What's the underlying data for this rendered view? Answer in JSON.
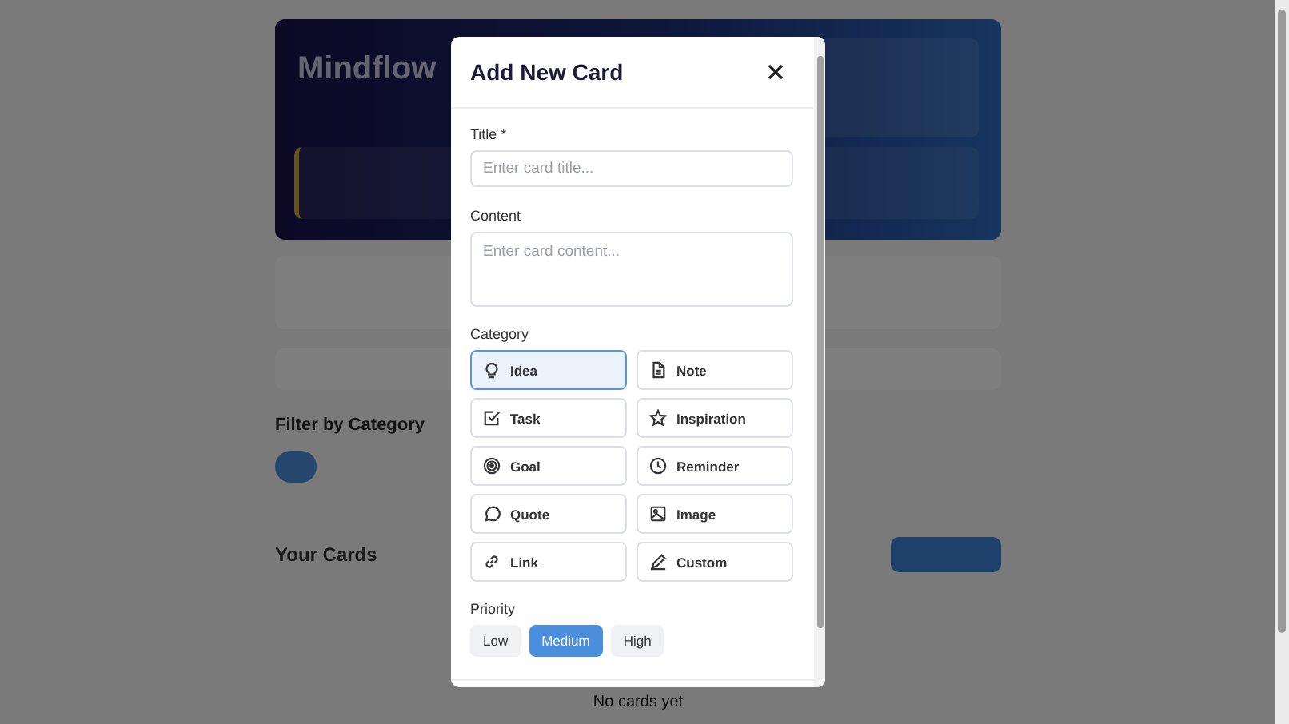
{
  "background": {
    "app_title": "Mindflow",
    "section_title": "Filter by Category",
    "cards_heading": "Your Cards",
    "empty_message": "No cards yet"
  },
  "dialog": {
    "title": "Add New Card",
    "fields": [
      {
        "kind": "input",
        "label": "Title *",
        "placeholder": "Enter card title..."
      },
      {
        "kind": "textarea",
        "label": "Content",
        "placeholder": "Enter card content..."
      }
    ],
    "category_label": "Category",
    "categories": [
      {
        "label": "Idea",
        "selected": true
      },
      {
        "label": "Note",
        "selected": false
      },
      {
        "label": "Task",
        "selected": false
      },
      {
        "label": "Inspiration",
        "selected": false
      },
      {
        "label": "Goal",
        "selected": false
      },
      {
        "label": "Reminder",
        "selected": false
      },
      {
        "label": "Quote",
        "selected": false
      },
      {
        "label": "Image",
        "selected": false
      },
      {
        "label": "Link",
        "selected": false
      },
      {
        "label": "Custom",
        "selected": false
      }
    ],
    "priority_label": "Priority",
    "priorities": [
      {
        "label": "Low",
        "selected": false
      },
      {
        "label": "Medium",
        "selected": true
      },
      {
        "label": "High",
        "selected": false
      }
    ]
  }
}
